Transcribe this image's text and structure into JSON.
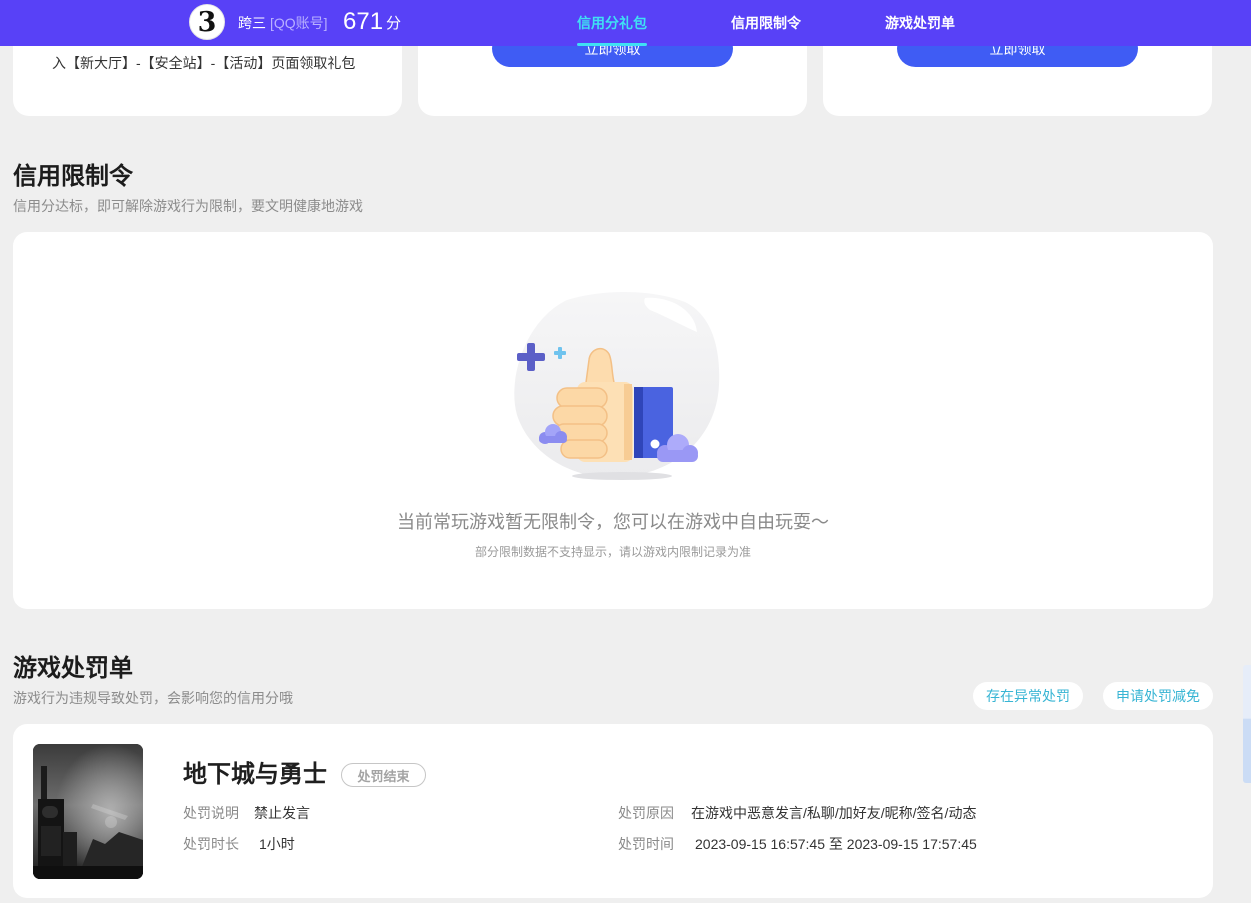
{
  "header": {
    "avatar_glyph": "3",
    "username": "跨三",
    "account_type": "[QQ账号]",
    "score": "671",
    "score_unit": "分",
    "nav": [
      {
        "label": "信用分礼包",
        "active": true
      },
      {
        "label": "信用限制令",
        "active": false
      },
      {
        "label": "游戏处罚单",
        "active": false
      }
    ]
  },
  "gift_cards": [
    {
      "text": "入【新大厅】-【安全站】-【活动】页面领取礼包"
    },
    {
      "button": "立即领取"
    },
    {
      "button": "立即领取"
    }
  ],
  "restriction": {
    "title": "信用限制令",
    "subtitle": "信用分达标，即可解除游戏行为限制，要文明健康地游戏",
    "illustration_icon": "thumbs-up-icon",
    "empty_message": "当前常玩游戏暂无限制令，您可以在游戏中自由玩耍～",
    "empty_note": "部分限制数据不支持显示，请以游戏内限制记录为准"
  },
  "penalty": {
    "title": "游戏处罚单",
    "subtitle": "游戏行为违规导致处罚，会影响您的信用分哦",
    "actions": [
      "存在异常处罚",
      "申请处罚减免"
    ],
    "records": [
      {
        "game": "地下城与勇士",
        "status": "处罚结束",
        "desc_label": "处罚说明",
        "desc": "禁止发言",
        "duration_label": "处罚时长",
        "duration": "1小时",
        "reason_label": "处罚原因",
        "reason": "在游戏中恶意发言/私聊/加好友/昵称/签名/动态",
        "time_label": "处罚时间",
        "time": "2023-09-15 16:57:45 至 2023-09-15 17:57:45"
      }
    ]
  },
  "colors": {
    "header_bg": "#5841f7",
    "nav_active": "#3fe0f4",
    "primary_button": "#3f5cf4",
    "link_cyan": "#38b5d4",
    "page_bg": "#efefef"
  }
}
